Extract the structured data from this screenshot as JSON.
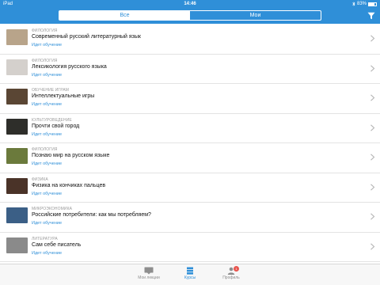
{
  "status_bar": {
    "device": "iPad",
    "time": "14:46",
    "battery_percent": "83%",
    "battery_level": 0.83
  },
  "segments": {
    "all": "Все",
    "mine": "Мои"
  },
  "courses": [
    {
      "category": "ФИЛОЛОГИЯ",
      "title": "Современный русский литературный язык",
      "status": "Идет обучение",
      "thumb_color": "#b8a48a"
    },
    {
      "category": "ФИЛОЛОГИЯ",
      "title": "Лексикология русского языка",
      "status": "Идет обучение",
      "thumb_color": "#d4d0cc"
    },
    {
      "category": "ОБУЧЕНИЕ ИГРАМ",
      "title": "Интеллектуальные игры",
      "status": "Идет обучение",
      "thumb_color": "#5a4634"
    },
    {
      "category": "КУЛЬТУРОВЕДЕНИЕ",
      "title": "Прочти свой город",
      "status": "Идет обучение",
      "thumb_color": "#2e2e2a"
    },
    {
      "category": "ФИЛОЛОГИЯ",
      "title": "Познаю мир на русском языке",
      "status": "Идет обучение",
      "thumb_color": "#6b7a3c"
    },
    {
      "category": "ФИЗИКА",
      "title": "Физика на кончиках пальцев",
      "status": "Идет обучение",
      "thumb_color": "#4a3328"
    },
    {
      "category": "МИКРОЭКОНОМИКА",
      "title": "Российские потребители: как мы потребляем?",
      "status": "Идет обучение",
      "thumb_color": "#3b5f86"
    },
    {
      "category": "ЛИТЕРАТУРА",
      "title": "Сам себе писатель",
      "status": "Идет обучение",
      "thumb_color": "#8a8a8a"
    }
  ],
  "tabs": {
    "lectures": "Мои лекции",
    "courses": "Курсы",
    "profile": "Профиль",
    "profile_badge": "1"
  },
  "colors": {
    "accent": "#2f8fd8"
  }
}
